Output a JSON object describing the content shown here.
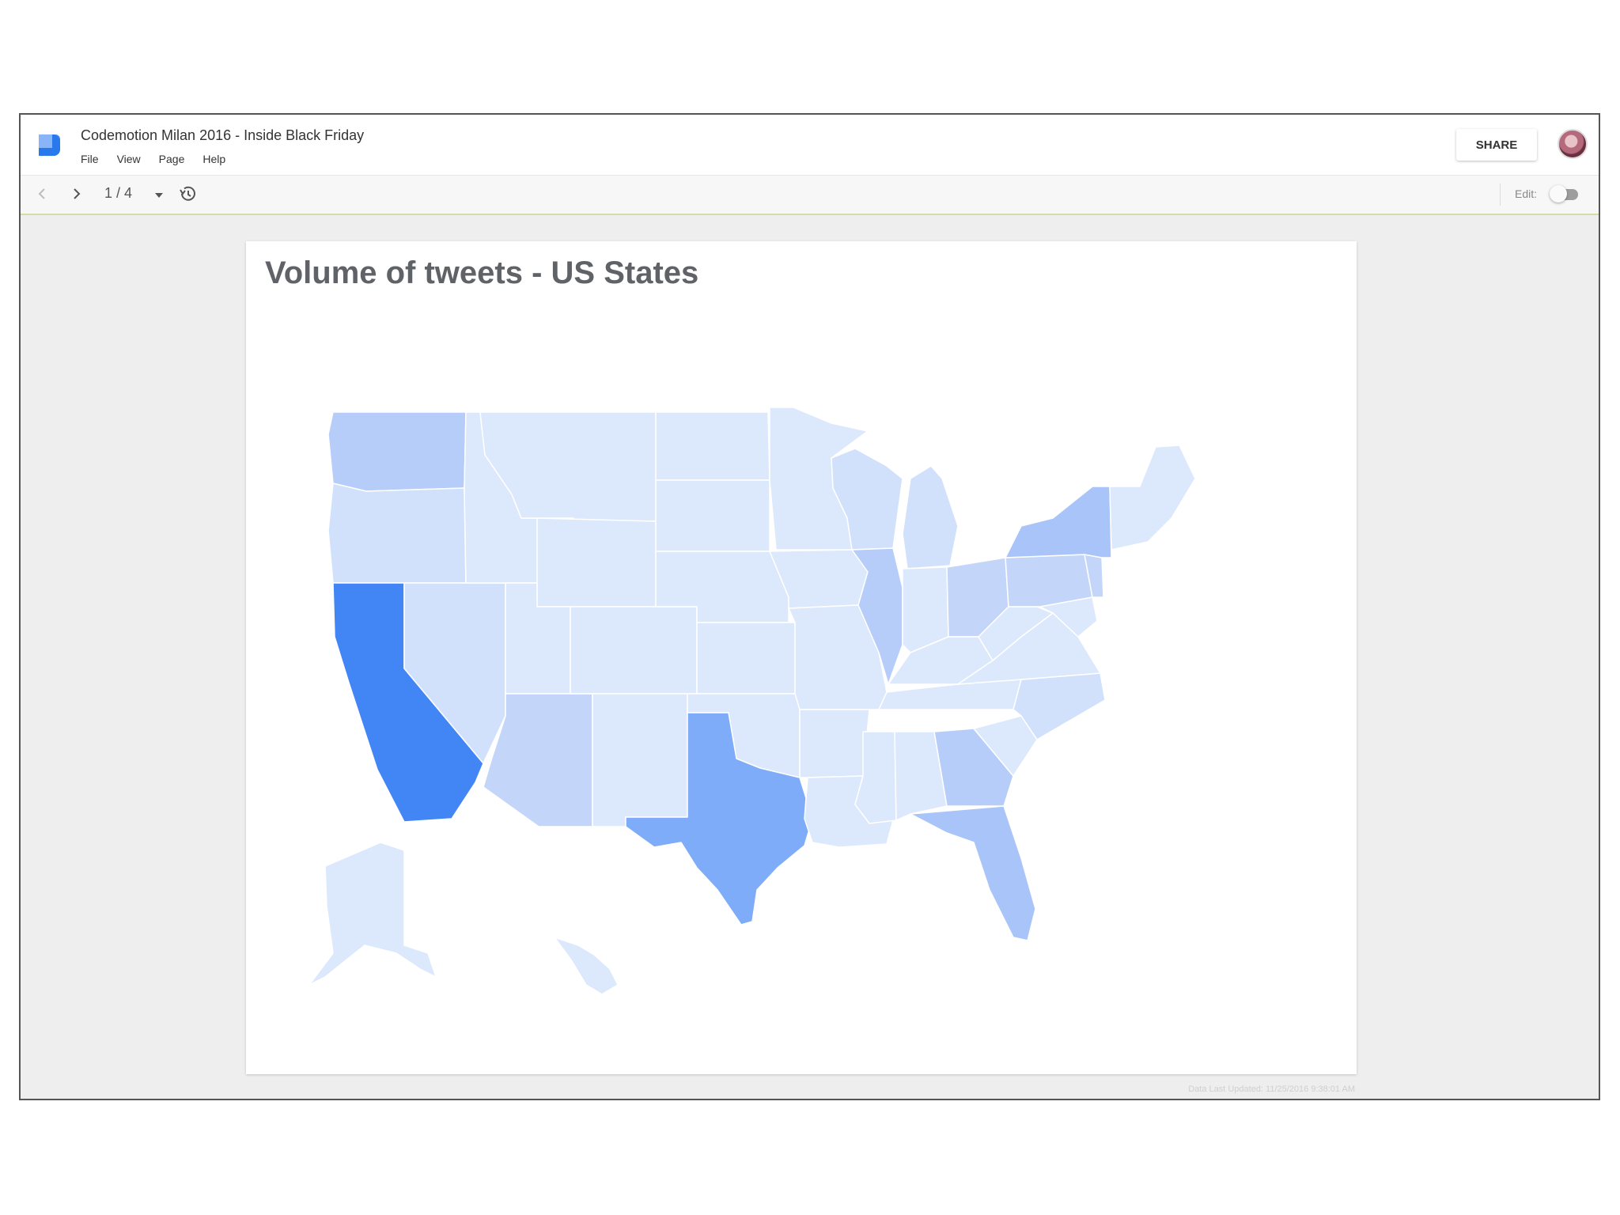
{
  "app": {
    "title": "Codemotion Milan 2016 - Inside Black Friday",
    "menu": [
      "File",
      "View",
      "Page",
      "Help"
    ],
    "share_label": "SHARE"
  },
  "toolbar": {
    "page_current": "1",
    "page_total": "4",
    "page_label": "1 / 4",
    "edit_label": "Edit:",
    "edit_enabled": false
  },
  "slide": {
    "title": "Volume of tweets - US States"
  },
  "footer": {
    "updated": "Data Last Updated: 11/25/2016 9:38:01 AM"
  },
  "colors": {
    "accent": "#4285f4",
    "map_light": "#dce8fc",
    "map_mid": "#b6cdf9",
    "map_strong": "#7facf8",
    "map_max": "#4285f4"
  },
  "map_legend": {
    "highest": "California",
    "high": [
      "Texas"
    ],
    "medium": [
      "Florida",
      "New York",
      "Illinois",
      "Georgia",
      "Washington",
      "Ohio",
      "Arizona",
      "Pennsylvania"
    ]
  }
}
